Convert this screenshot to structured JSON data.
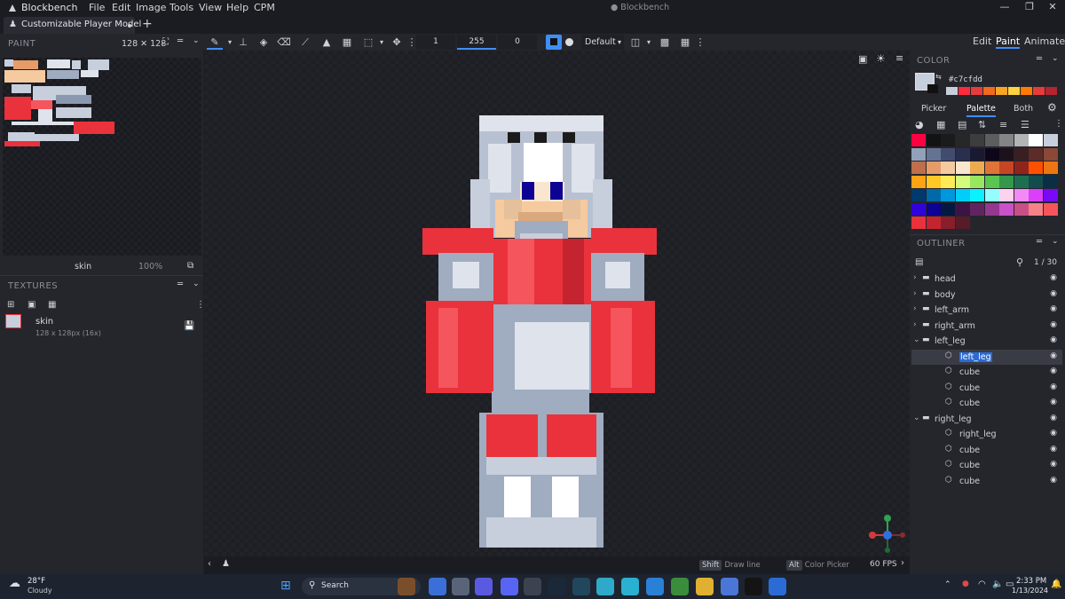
{
  "app": {
    "name": "Blockbench",
    "window_title": "● Blockbench",
    "menu": [
      "File",
      "Edit",
      "Image",
      "Tools",
      "View",
      "Help",
      "CPM"
    ],
    "tab_label": "Customizable Player Model"
  },
  "toolbar": {
    "brush_size": "1",
    "opacity": "255",
    "softness": "0",
    "blend_mode": "Default",
    "modes": [
      "Edit",
      "Paint",
      "Animate"
    ],
    "active_mode": "Paint"
  },
  "paint_panel": {
    "title": "PAINT",
    "size": "128 ✕ 128",
    "texture_name": "skin",
    "zoom": "100%"
  },
  "textures_panel": {
    "title": "TEXTURES",
    "items": [
      {
        "name": "skin",
        "meta": "128 x 128px (16x)"
      }
    ]
  },
  "color_panel": {
    "title": "COLOR",
    "hex": "#c7cfdd",
    "current_color": "#c7cfdd",
    "tabs": [
      "Picker",
      "Palette",
      "Both"
    ],
    "active_tab": "Palette",
    "recent": [
      "#c7cfdd",
      "#ff2a3c",
      "#e83c3c",
      "#f06a1f",
      "#f6a623",
      "#ffd23f",
      "#ff7a00",
      "#e83a3a",
      "#b4252f"
    ],
    "palette": [
      [
        "#ff0040",
        "#131313",
        "#1b1b1b",
        "#272727",
        "#3d3d3d",
        "#5d5d5d",
        "#858585",
        "#b4b4b4",
        "#ffffff",
        "#c7cfdd"
      ],
      [
        "#92a1b9",
        "#657392",
        "#424c6e",
        "#2a2f4e",
        "#1a1932",
        "#0e071b",
        "#1c121c",
        "#391f21",
        "#5d2c28",
        "#8a4836"
      ],
      [
        "#bf6f4a",
        "#e69c69",
        "#f6ca9f",
        "#f9e6cf",
        "#edab50",
        "#e07438",
        "#c64524",
        "#8e251d",
        "#ff5000",
        "#ed7614"
      ],
      [
        "#ffa214",
        "#ffc825",
        "#ffeb57",
        "#d3fc7e",
        "#99e65f",
        "#5ac54f",
        "#33984b",
        "#1e6f50",
        "#134c4c",
        "#0c2e44"
      ],
      [
        "#00396d",
        "#0069aa",
        "#0098dc",
        "#00cdf9",
        "#0cf1ff",
        "#94fdff",
        "#fdd2ed",
        "#f389f5",
        "#db3ffd",
        "#7a09fa"
      ],
      [
        "#3003d9",
        "#0c0293",
        "#03193f",
        "#3b1443",
        "#622461",
        "#93388f",
        "#ca52c9",
        "#c85086",
        "#f68187",
        "#f5555d"
      ],
      [
        "#ea323c",
        "#c42430",
        "#891e2b",
        "#571c27"
      ]
    ]
  },
  "outliner": {
    "title": "OUTLINER",
    "count": "1 / 30",
    "rows": [
      {
        "label": "head",
        "type": "group",
        "expanded": false,
        "depth": 0
      },
      {
        "label": "body",
        "type": "group",
        "expanded": false,
        "depth": 0
      },
      {
        "label": "left_arm",
        "type": "group",
        "expanded": false,
        "depth": 0
      },
      {
        "label": "right_arm",
        "type": "group",
        "expanded": false,
        "depth": 0
      },
      {
        "label": "left_leg",
        "type": "group",
        "expanded": true,
        "depth": 0
      },
      {
        "label": "left_leg",
        "type": "cube",
        "depth": 1,
        "selected": true,
        "editing": true
      },
      {
        "label": "cube",
        "type": "cube",
        "depth": 1
      },
      {
        "label": "cube",
        "type": "cube",
        "depth": 1
      },
      {
        "label": "cube",
        "type": "cube",
        "depth": 1
      },
      {
        "label": "right_leg",
        "type": "group",
        "expanded": true,
        "depth": 0
      },
      {
        "label": "right_leg",
        "type": "cube",
        "depth": 1
      },
      {
        "label": "cube",
        "type": "cube",
        "depth": 1
      },
      {
        "label": "cube",
        "type": "cube",
        "depth": 1
      },
      {
        "label": "cube",
        "type": "cube",
        "depth": 1
      }
    ]
  },
  "statusbar": {
    "hint1_key": "Shift",
    "hint1_text": "Draw line",
    "hint2_key": "Alt",
    "hint2_text": "Color Picker",
    "fps": "60 FPS"
  },
  "taskbar": {
    "weather_temp": "28°F",
    "weather_desc": "Cloudy",
    "search_label": "Search",
    "time": "2:33 PM",
    "date": "1/13/2024"
  }
}
